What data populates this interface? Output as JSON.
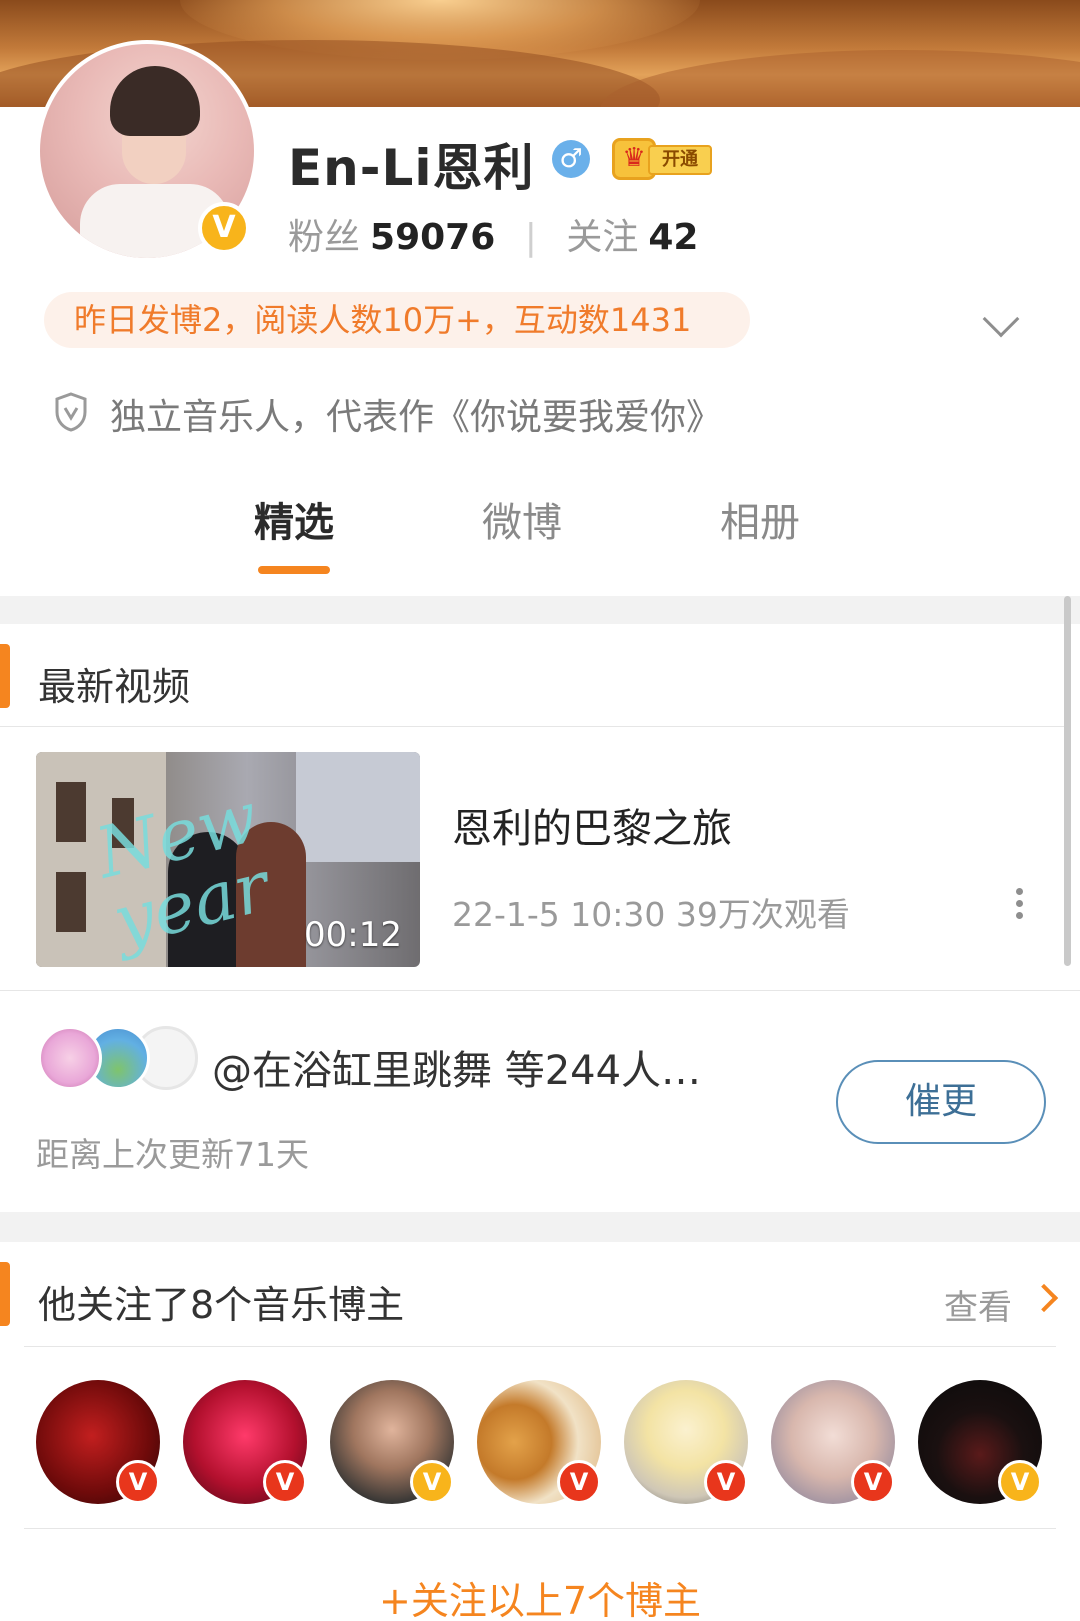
{
  "profile": {
    "name": "En-Li恩利",
    "gender_symbol": "♂",
    "vip_label": "开通",
    "verified_badge": "V",
    "followers_label": "粉丝",
    "followers_count": "59076",
    "following_label": "关注",
    "following_count": "42",
    "separator": "|",
    "summary": "昨日发博2，阅读人数10万+，互动数1431",
    "bio": "独立音乐人，代表作《你说要我爱你》"
  },
  "tabs": [
    "精选",
    "微博",
    "相册"
  ],
  "active_tab": "精选",
  "latest_video": {
    "section_title": "最新视频",
    "title": "恩利的巴黎之旅",
    "meta": "22-1-5  10:30  39万次观看",
    "duration": "00:12",
    "thumb_text": "New year"
  },
  "urge": {
    "fans_text": "@在浴缸里跳舞  等244人…",
    "last_update": "距离上次更新71天",
    "button_label": "催更"
  },
  "music_bloggers": {
    "section_title": "他关注了8个音乐博主",
    "view_label": "查看",
    "badges": [
      "V",
      "V",
      "V",
      "V",
      "V",
      "V",
      "V"
    ],
    "follow_all_label": "+关注以上7个博主"
  },
  "colors": {
    "accent": "#f5851f",
    "verified_gold": "#f8b41b",
    "verified_red": "#e8361c",
    "summary_bg": "#fdf1ea",
    "urge_border": "#5a8fb8"
  }
}
